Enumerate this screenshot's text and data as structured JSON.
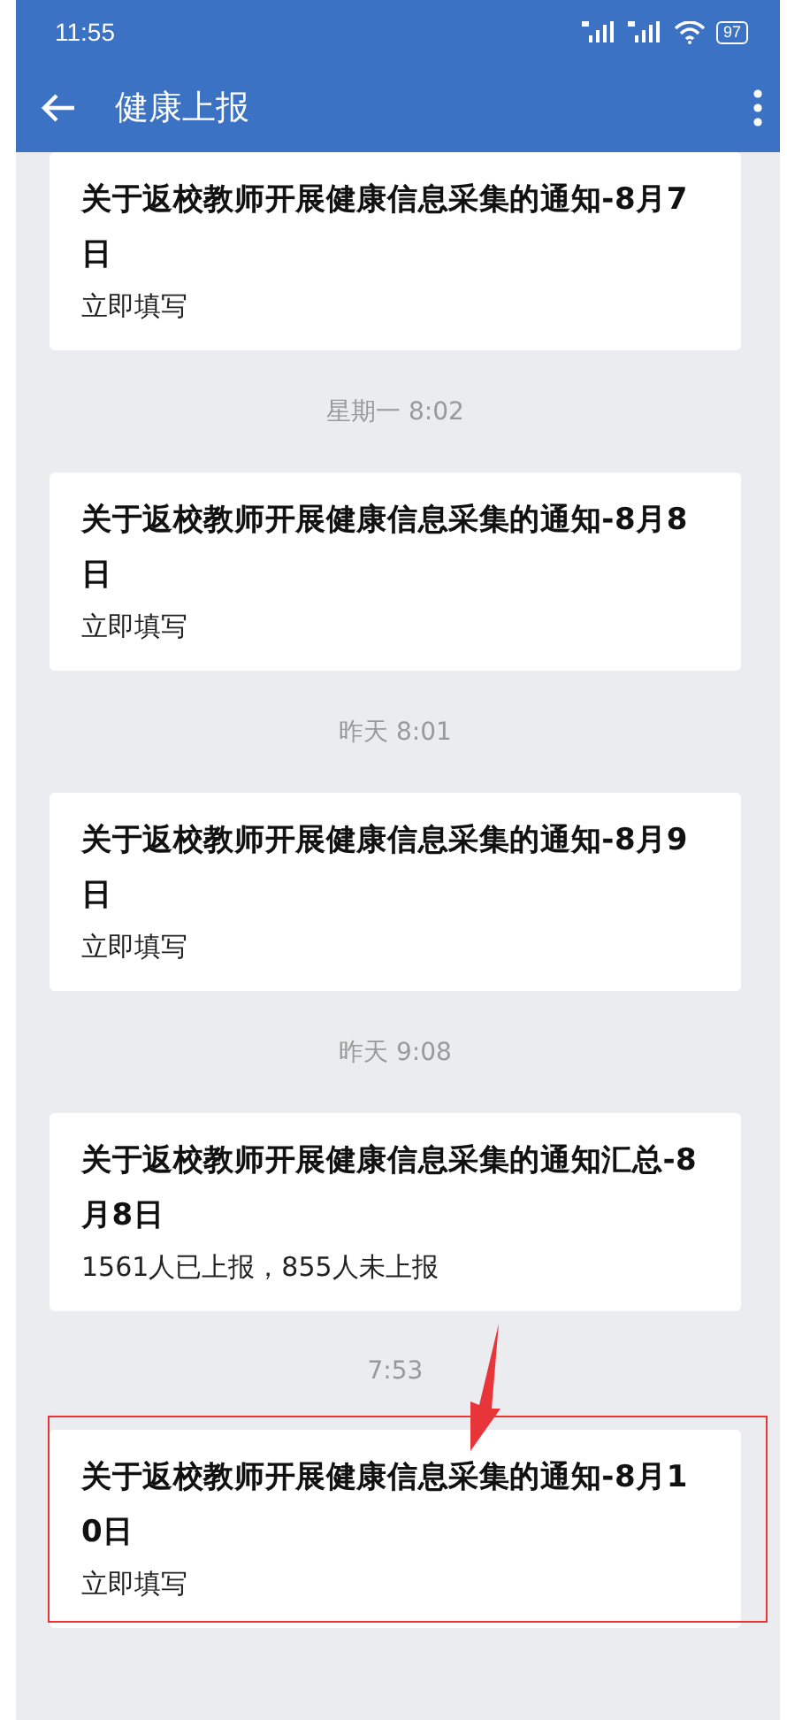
{
  "status_bar": {
    "time": "11:55",
    "battery": "97"
  },
  "toolbar": {
    "title": "健康上报"
  },
  "feed": [
    {
      "kind": "card",
      "title": "关于返校教师开展健康信息采集的通知-8月7日",
      "subtitle": "立即填写",
      "highlighted": false
    },
    {
      "kind": "time",
      "text": "星期一 8:02"
    },
    {
      "kind": "card",
      "title": "关于返校教师开展健康信息采集的通知-8月8日",
      "subtitle": "立即填写",
      "highlighted": false
    },
    {
      "kind": "time",
      "text": "昨天 8:01"
    },
    {
      "kind": "card",
      "title": "关于返校教师开展健康信息采集的通知-8月9日",
      "subtitle": "立即填写",
      "highlighted": false
    },
    {
      "kind": "time",
      "text": "昨天 9:08"
    },
    {
      "kind": "card",
      "title": "关于返校教师开展健康信息采集的通知汇总-8月8日",
      "subtitle": "1561人已上报，855人未上报",
      "highlighted": false
    },
    {
      "kind": "time",
      "text": "7:53"
    },
    {
      "kind": "card",
      "title": "关于返校教师开展健康信息采集的通知-8月10日",
      "subtitle": "立即填写",
      "highlighted": true
    }
  ]
}
